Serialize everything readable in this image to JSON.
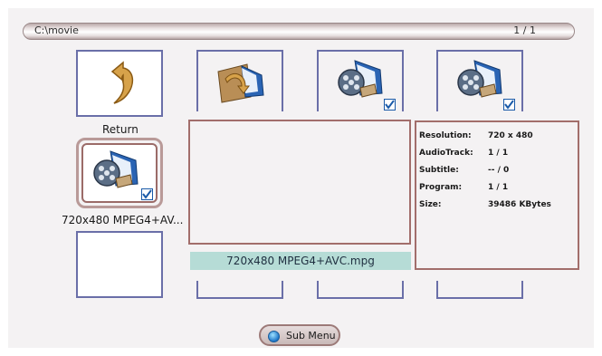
{
  "header": {
    "path": "C:\\movie",
    "page_indicator": "1 / 1"
  },
  "browser": {
    "return_label": "Return",
    "selected_item_label": "720x480 MPEG4+AV...",
    "filename": "720x480 MPEG4+AVC.mpg"
  },
  "info": {
    "resolution_label": "Resolution:",
    "resolution_value": "720 x 480",
    "audiotrack_label": "AudioTrack:",
    "audiotrack_value": "1 / 1",
    "subtitle_label": "Subtitle:",
    "subtitle_value": "-- / 0",
    "program_label": "Program:",
    "program_value": "1 / 1",
    "size_label": "Size:",
    "size_value": "39486 KBytes"
  },
  "footer": {
    "submenu_label": "Sub Menu"
  },
  "colors": {
    "tile_border": "#6a6fa8",
    "selection_border": "#9b6b68",
    "filename_bg": "#b6dcd6"
  },
  "icons": {
    "return": "return-arrow-icon",
    "folder": "folder-back-icon",
    "video": "video-file-icon",
    "check": "checkbox-icon"
  }
}
